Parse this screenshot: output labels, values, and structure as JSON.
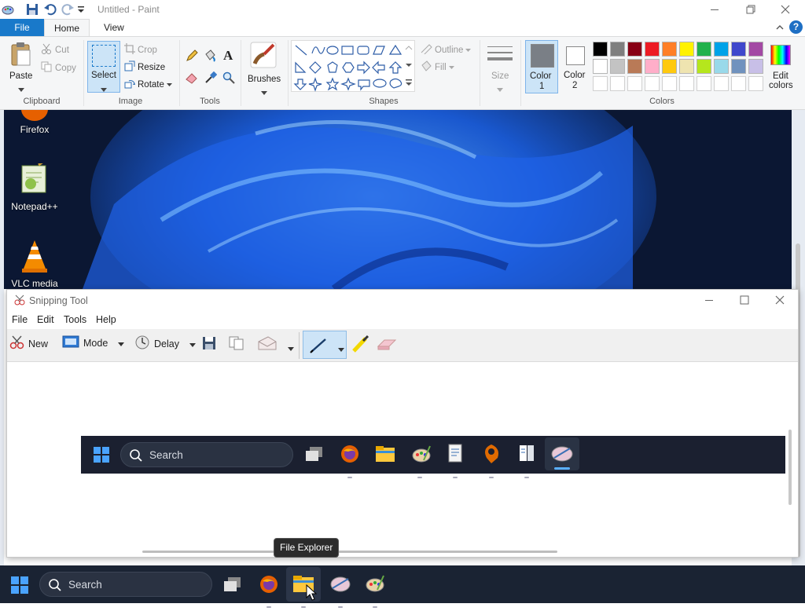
{
  "paint": {
    "title": "Untitled - Paint",
    "tabs": {
      "file": "File",
      "home": "Home",
      "view": "View"
    },
    "clipboard": {
      "paste": "Paste",
      "cut": "Cut",
      "copy": "Copy",
      "label": "Clipboard"
    },
    "image": {
      "select": "Select",
      "crop": "Crop",
      "resize": "Resize",
      "rotate": "Rotate",
      "label": "Image"
    },
    "tools": {
      "label": "Tools",
      "text_glyph": "A"
    },
    "brushes": {
      "label": "Brushes"
    },
    "shapes": {
      "outline": "Outline",
      "fill": "Fill",
      "label": "Shapes"
    },
    "size": {
      "label": "Size"
    },
    "color1": {
      "label1": "Color",
      "label2": "1",
      "value": "#7a7f86"
    },
    "color2": {
      "label1": "Color",
      "label2": "2",
      "value": "#ffffff"
    },
    "colors": {
      "label": "Colors",
      "edit1": "Edit",
      "edit2": "colors",
      "row1": [
        "#000000",
        "#7f7f7f",
        "#880015",
        "#ed1c24",
        "#ff7f27",
        "#fff200",
        "#22b14c",
        "#00a2e8",
        "#3f48cc",
        "#a349a4"
      ],
      "row2": [
        "#ffffff",
        "#c3c3c3",
        "#b97a57",
        "#ffaec9",
        "#ffc90e",
        "#efe4b0",
        "#b5e61d",
        "#99d9ea",
        "#7092be",
        "#c8bfe7"
      ],
      "row3": [
        "#ffffff",
        "#ffffff",
        "#ffffff",
        "#ffffff",
        "#ffffff",
        "#ffffff",
        "#ffffff",
        "#ffffff",
        "#ffffff",
        "#ffffff"
      ]
    },
    "help_glyph": "?"
  },
  "desktop": {
    "icons": [
      {
        "label": "Firefox"
      },
      {
        "label": "Notepad++"
      },
      {
        "label": "VLC media"
      }
    ]
  },
  "snip": {
    "title": "Snipping Tool",
    "menu": [
      "File",
      "Edit",
      "Tools",
      "Help"
    ],
    "toolbar": {
      "new": "New",
      "mode": "Mode",
      "delay": "Delay"
    },
    "captured_search": "Search"
  },
  "taskbar": {
    "search": "Search",
    "tooltip": "File Explorer"
  }
}
